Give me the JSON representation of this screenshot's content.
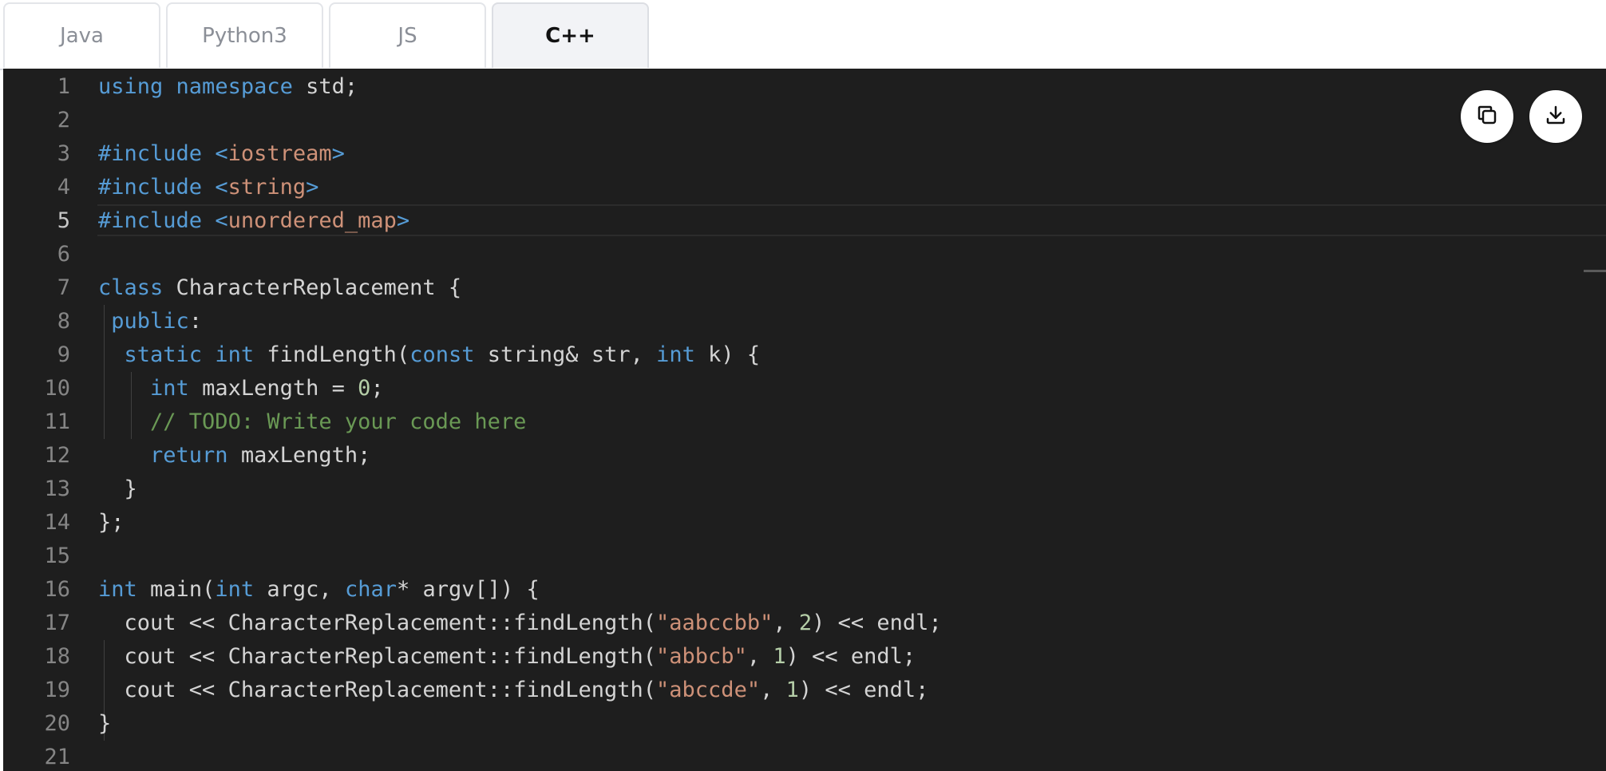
{
  "tabs": [
    {
      "label": "Java",
      "active": false
    },
    {
      "label": "Python3",
      "active": false
    },
    {
      "label": "JS",
      "active": false
    },
    {
      "label": "C++",
      "active": true
    }
  ],
  "editor": {
    "language": "C++",
    "current_line": 5,
    "lines": [
      "using namespace std;",
      "",
      "#include <iostream>",
      "#include <string>",
      "#include <unordered_map>",
      "",
      "class CharacterReplacement {",
      " public:",
      "  static int findLength(const string& str, int k) {",
      "    int maxLength = 0;",
      "    // TODO: Write your code here",
      "    return maxLength;",
      "  }",
      "};",
      "",
      "int main(int argc, char* argv[]) {",
      "  cout << CharacterReplacement::findLength(\"aabccbb\", 2) << endl;",
      "  cout << CharacterReplacement::findLength(\"abbcb\", 1) << endl;",
      "  cout << CharacterReplacement::findLength(\"abccde\", 1) << endl;",
      "}",
      ""
    ]
  },
  "actions": {
    "copy_icon": "copy-icon",
    "download_icon": "download-icon"
  },
  "colors": {
    "keyword": "#569cd6",
    "string": "#ce9178",
    "number": "#b5cea8",
    "comment": "#6a9955",
    "editor_bg": "#1e1e1e"
  }
}
